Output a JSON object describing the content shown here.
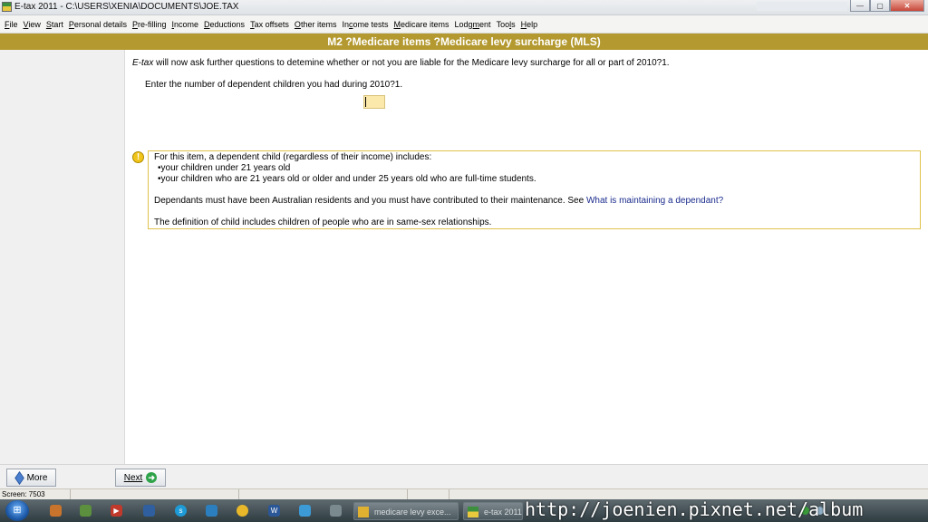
{
  "window": {
    "title": "E-tax 2011 - C:\\USERS\\XENIA\\DOCUMENTS\\JOE.TAX",
    "buttons": {
      "minimize": "—",
      "maximize": "▢",
      "close": "✕"
    }
  },
  "menu": [
    {
      "u": "F",
      "rest": "ile"
    },
    {
      "u": "V",
      "rest": "iew"
    },
    {
      "pre": "",
      "u": "S",
      "rest": "tart"
    },
    {
      "pre": "",
      "u": "P",
      "rest": "ersonal details"
    },
    {
      "pre": "",
      "u": "P",
      "rest": "re-filling"
    },
    {
      "pre": "",
      "u": "I",
      "rest": "ncome"
    },
    {
      "pre": "",
      "u": "D",
      "rest": "eductions"
    },
    {
      "pre": "",
      "u": "T",
      "rest": "ax offsets"
    },
    {
      "pre": "",
      "u": "O",
      "rest": "ther items"
    },
    {
      "pre": "In",
      "u": "c",
      "rest": "ome tests"
    },
    {
      "pre": "",
      "u": "M",
      "rest": "edicare items"
    },
    {
      "pre": "Lodg",
      "u": "m",
      "rest": "ent"
    },
    {
      "pre": "Too",
      "u": "l",
      "rest": "s"
    },
    {
      "pre": "",
      "u": "H",
      "rest": "elp"
    }
  ],
  "section": {
    "title": "M2 ?Medicare items ?Medicare levy surcharge (MLS)"
  },
  "main": {
    "intro_app": "E-tax",
    "intro_rest": " will now ask further questions to detemine whether or not you are liable for the Medicare levy surcharge for all or part of 2010?1.",
    "prompt": "Enter the number of dependent children you had during 2010?1.",
    "children_value": ""
  },
  "info": {
    "icon": "!",
    "line1": "For this item, a dependent child (regardless of their income) includes:",
    "bullet1": "•your children under 21 years old",
    "bullet2": "•your children who are 21 years old or older and under 25 years old who are full-time students.",
    "line2_text": "Dependants must have been Australian residents and you must have contributed to their maintenance. See ",
    "line2_link": "What is maintaining a dependant?",
    "line3": "The definition of child includes children of people who are in same-sex relationships."
  },
  "buttons": {
    "more": "More",
    "next": "Next"
  },
  "status": {
    "screen": "Screen: 7503"
  },
  "taskbar": {
    "task1": "medicare levy exce...",
    "task2": "e-tax 2011",
    "watermark": "http://joenien.pixnet.net/album"
  },
  "colors": {
    "section_header": "#b3992f",
    "input_bg": "#fbe9ac",
    "info_border": "#e0c24a",
    "link": "#1a2b8c"
  }
}
